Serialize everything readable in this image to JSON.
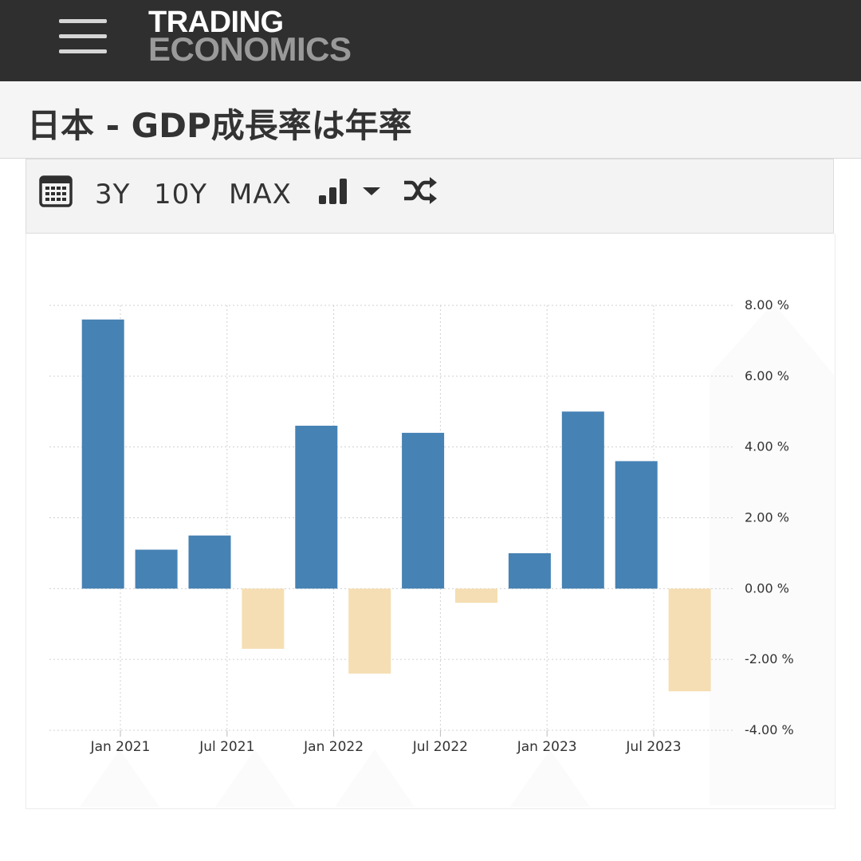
{
  "header": {
    "logo_line1": "TRADING",
    "logo_line2": "ECONOMICS"
  },
  "page_title": "日本 - GDP成長率は年率",
  "toolbar": {
    "calendar_icon": "calendar-icon",
    "ranges": [
      "3Y",
      "10Y",
      "MAX"
    ],
    "chart_type_icon": "bar-chart-icon",
    "dropdown_icon": "caret-down-icon",
    "shuffle_icon": "shuffle-icon"
  },
  "colors": {
    "positive": "#4682b4",
    "negative": "#f5deb3",
    "header_bg": "#2f2f2f"
  },
  "chart_data": {
    "type": "bar",
    "title": "",
    "xlabel": "",
    "ylabel": "",
    "x_tick_labels": [
      "Jan 2021",
      "Jul 2021",
      "Jan 2022",
      "Jul 2022",
      "Jan 2023",
      "Jul 2023"
    ],
    "y_tick_labels": [
      "8.00 %",
      "6.00 %",
      "4.00 %",
      "2.00 %",
      "0.00 %",
      "-2.00 %",
      "-4.00 %"
    ],
    "ylim": [
      -4,
      8
    ],
    "y_axis_position": "right",
    "grid": true,
    "categories": [
      "2020-12",
      "2021-03",
      "2021-06",
      "2021-09",
      "2021-12",
      "2022-03",
      "2022-06",
      "2022-09",
      "2022-12",
      "2023-03",
      "2023-06",
      "2023-09"
    ],
    "values": [
      7.6,
      1.1,
      1.5,
      -1.7,
      4.6,
      -2.4,
      4.4,
      -0.4,
      1.0,
      5.0,
      3.6,
      -2.9
    ]
  }
}
